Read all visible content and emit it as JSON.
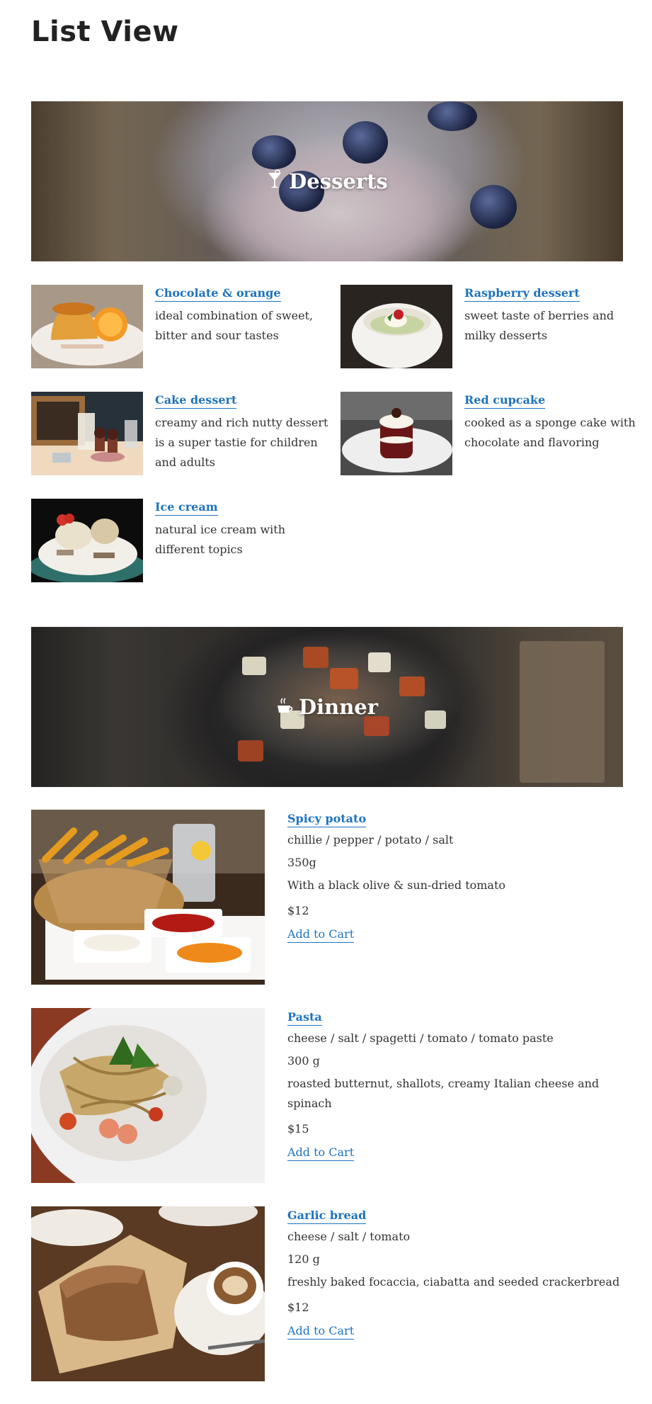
{
  "page": {
    "title": "List View"
  },
  "sections": {
    "desserts": {
      "title": "Desserts",
      "icon": "cocktail-glass-icon",
      "items": [
        {
          "name": "Chocolate & orange",
          "description": "ideal combination of sweet, bitter and sour tastes"
        },
        {
          "name": "Raspberry dessert",
          "description": "sweet taste of berries and milky desserts"
        },
        {
          "name": "Cake dessert",
          "description": "creamy and rich nutty dessert is a super tastie for children and adults"
        },
        {
          "name": "Red cupcake",
          "description": "cooked as a sponge cake with chocolate and flavoring"
        },
        {
          "name": "Ice cream",
          "description": "natural ice cream with different topics"
        }
      ]
    },
    "dinner": {
      "title": "Dinner",
      "icon": "steaming-cup-icon",
      "items": [
        {
          "name": "Spicy potato",
          "ingredients": "chillie / pepper / potato / salt",
          "weight": "350g",
          "description": "With a black olive & sun-dried tomato",
          "price": "$12",
          "cart_label": "Add to Cart"
        },
        {
          "name": "Pasta",
          "ingredients": "cheese / salt / spagetti / tomato / tomato paste",
          "weight": "300 g",
          "description": "roasted butternut, shallots, creamy Italian cheese and spinach",
          "price": "$15",
          "cart_label": "Add to Cart"
        },
        {
          "name": "Garlic bread",
          "ingredients": "cheese / salt / tomato",
          "weight": "120 g",
          "description": "freshly baked focaccia, ciabatta and seeded crackerbread",
          "price": "$12",
          "cart_label": "Add to Cart"
        }
      ]
    }
  },
  "colors": {
    "link": "#1e73be",
    "text": "#333333",
    "heading": "#222222"
  }
}
